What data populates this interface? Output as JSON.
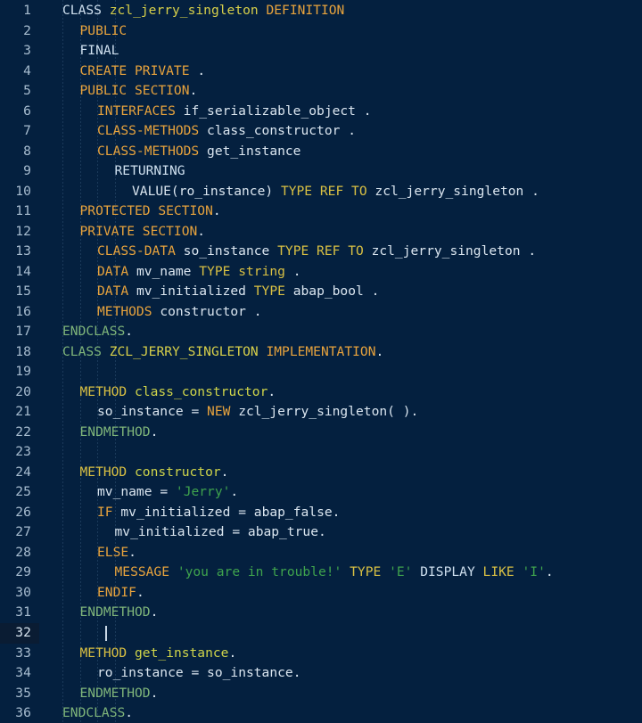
{
  "editor": {
    "language": "ABAP",
    "theme_background": "#04203f",
    "gutter_active_background": "#0a1c33",
    "colors": {
      "keyword_orange": "#e8a33d",
      "keyword_gold": "#d9c043",
      "identifier": "#dbe6f0",
      "class_name": "#d8d04a",
      "method_name": "#cfd44a",
      "string": "#3fa34d",
      "green_keyword": "#7fb57a",
      "light_blue": "#cfe0ef",
      "line_number": "#a8bdd0"
    },
    "cursor_line": 32,
    "total_lines": 36,
    "line_numbers": [
      1,
      2,
      3,
      4,
      5,
      6,
      7,
      8,
      9,
      10,
      11,
      12,
      13,
      14,
      15,
      16,
      17,
      18,
      19,
      20,
      21,
      22,
      23,
      24,
      25,
      26,
      27,
      28,
      29,
      30,
      31,
      32,
      33,
      34,
      35,
      36
    ],
    "lines": [
      {
        "num": 1,
        "indent": 0,
        "tokens": [
          {
            "t": "CLASS",
            "c": "lblue"
          },
          {
            "t": " ",
            "c": "id"
          },
          {
            "t": "zcl_jerry_singleton",
            "c": "cls"
          },
          {
            "t": " ",
            "c": "id"
          },
          {
            "t": "DEFINITION",
            "c": "kw"
          }
        ]
      },
      {
        "num": 2,
        "indent": 1,
        "tokens": [
          {
            "t": "PUBLIC",
            "c": "kw"
          }
        ]
      },
      {
        "num": 3,
        "indent": 1,
        "tokens": [
          {
            "t": "FINAL",
            "c": "lblue"
          }
        ]
      },
      {
        "num": 4,
        "indent": 1,
        "tokens": [
          {
            "t": "CREATE PRIVATE",
            "c": "kw"
          },
          {
            "t": " ",
            "c": "id"
          },
          {
            "t": ".",
            "c": "punct"
          }
        ]
      },
      {
        "num": 5,
        "indent": 1,
        "tokens": [
          {
            "t": "PUBLIC SECTION",
            "c": "kw"
          },
          {
            "t": ".",
            "c": "punct"
          }
        ]
      },
      {
        "num": 6,
        "indent": 2,
        "tokens": [
          {
            "t": "INTERFACES",
            "c": "kw"
          },
          {
            "t": " ",
            "c": "id"
          },
          {
            "t": "if_serializable_object",
            "c": "id"
          },
          {
            "t": " ",
            "c": "id"
          },
          {
            "t": ".",
            "c": "punct"
          }
        ]
      },
      {
        "num": 7,
        "indent": 2,
        "tokens": [
          {
            "t": "CLASS-METHODS",
            "c": "kw"
          },
          {
            "t": " ",
            "c": "id"
          },
          {
            "t": "class_constructor",
            "c": "id"
          },
          {
            "t": " ",
            "c": "id"
          },
          {
            "t": ".",
            "c": "punct"
          }
        ]
      },
      {
        "num": 8,
        "indent": 2,
        "tokens": [
          {
            "t": "CLASS-METHODS",
            "c": "kw"
          },
          {
            "t": " ",
            "c": "id"
          },
          {
            "t": "get_instance",
            "c": "id"
          }
        ]
      },
      {
        "num": 9,
        "indent": 3,
        "tokens": [
          {
            "t": "RETURNING",
            "c": "lblue"
          }
        ]
      },
      {
        "num": 10,
        "indent": 4,
        "tokens": [
          {
            "t": "VALUE(ro_instance)",
            "c": "id"
          },
          {
            "t": " ",
            "c": "id"
          },
          {
            "t": "TYPE REF TO",
            "c": "kw2"
          },
          {
            "t": " ",
            "c": "id"
          },
          {
            "t": "zcl_jerry_singleton",
            "c": "id"
          },
          {
            "t": " ",
            "c": "id"
          },
          {
            "t": ".",
            "c": "punct"
          }
        ]
      },
      {
        "num": 11,
        "indent": 1,
        "tokens": [
          {
            "t": "PROTECTED SECTION",
            "c": "kw"
          },
          {
            "t": ".",
            "c": "punct"
          }
        ]
      },
      {
        "num": 12,
        "indent": 1,
        "tokens": [
          {
            "t": "PRIVATE SECTION",
            "c": "kw"
          },
          {
            "t": ".",
            "c": "punct"
          }
        ]
      },
      {
        "num": 13,
        "indent": 2,
        "tokens": [
          {
            "t": "CLASS-DATA",
            "c": "kw"
          },
          {
            "t": " ",
            "c": "id"
          },
          {
            "t": "so_instance",
            "c": "id"
          },
          {
            "t": " ",
            "c": "id"
          },
          {
            "t": "TYPE REF TO",
            "c": "kw2"
          },
          {
            "t": " ",
            "c": "id"
          },
          {
            "t": "zcl_jerry_singleton",
            "c": "id"
          },
          {
            "t": " ",
            "c": "id"
          },
          {
            "t": ".",
            "c": "punct"
          }
        ]
      },
      {
        "num": 14,
        "indent": 2,
        "tokens": [
          {
            "t": "DATA",
            "c": "kw"
          },
          {
            "t": " ",
            "c": "id"
          },
          {
            "t": "mv_name",
            "c": "id"
          },
          {
            "t": " ",
            "c": "id"
          },
          {
            "t": "TYPE",
            "c": "kw2"
          },
          {
            "t": " ",
            "c": "id"
          },
          {
            "t": "string",
            "c": "kw2"
          },
          {
            "t": " ",
            "c": "id"
          },
          {
            "t": ".",
            "c": "punct"
          }
        ]
      },
      {
        "num": 15,
        "indent": 2,
        "tokens": [
          {
            "t": "DATA",
            "c": "kw"
          },
          {
            "t": " ",
            "c": "id"
          },
          {
            "t": "mv_initialized",
            "c": "id"
          },
          {
            "t": " ",
            "c": "id"
          },
          {
            "t": "TYPE",
            "c": "kw2"
          },
          {
            "t": " ",
            "c": "id"
          },
          {
            "t": "abap_bool",
            "c": "id"
          },
          {
            "t": " ",
            "c": "id"
          },
          {
            "t": ".",
            "c": "punct"
          }
        ]
      },
      {
        "num": 16,
        "indent": 2,
        "tokens": [
          {
            "t": "METHODS",
            "c": "kw"
          },
          {
            "t": " ",
            "c": "id"
          },
          {
            "t": "constructor",
            "c": "id"
          },
          {
            "t": " ",
            "c": "id"
          },
          {
            "t": ".",
            "c": "punct"
          }
        ]
      },
      {
        "num": 17,
        "indent": 0,
        "tokens": [
          {
            "t": "ENDCLASS",
            "c": "grn"
          },
          {
            "t": ".",
            "c": "punct"
          }
        ]
      },
      {
        "num": 18,
        "indent": 0,
        "tokens": [
          {
            "t": "CLASS",
            "c": "grn"
          },
          {
            "t": " ",
            "c": "id"
          },
          {
            "t": "ZCL_JERRY_SINGLETON",
            "c": "cls"
          },
          {
            "t": " ",
            "c": "id"
          },
          {
            "t": "IMPLEMENTATION",
            "c": "kw"
          },
          {
            "t": ".",
            "c": "punct"
          }
        ]
      },
      {
        "num": 19,
        "indent": 0,
        "tokens": []
      },
      {
        "num": 20,
        "indent": 1,
        "tokens": [
          {
            "t": "METHOD",
            "c": "kw2"
          },
          {
            "t": " ",
            "c": "id"
          },
          {
            "t": "class_constructor",
            "c": "mname"
          },
          {
            "t": ".",
            "c": "punct"
          }
        ]
      },
      {
        "num": 21,
        "indent": 2,
        "tokens": [
          {
            "t": "so_instance",
            "c": "id"
          },
          {
            "t": " ",
            "c": "id"
          },
          {
            "t": "=",
            "c": "op"
          },
          {
            "t": " ",
            "c": "id"
          },
          {
            "t": "NEW",
            "c": "kw"
          },
          {
            "t": " ",
            "c": "id"
          },
          {
            "t": "zcl_jerry_singleton( )",
            "c": "id"
          },
          {
            "t": ".",
            "c": "punct"
          }
        ]
      },
      {
        "num": 22,
        "indent": 1,
        "tokens": [
          {
            "t": "ENDMETHOD",
            "c": "grn"
          },
          {
            "t": ".",
            "c": "punct"
          }
        ]
      },
      {
        "num": 23,
        "indent": 0,
        "tokens": []
      },
      {
        "num": 24,
        "indent": 1,
        "tokens": [
          {
            "t": "METHOD",
            "c": "kw2"
          },
          {
            "t": " ",
            "c": "id"
          },
          {
            "t": "constructor",
            "c": "mname"
          },
          {
            "t": ".",
            "c": "punct"
          }
        ]
      },
      {
        "num": 25,
        "indent": 2,
        "tokens": [
          {
            "t": "mv_name",
            "c": "id"
          },
          {
            "t": " ",
            "c": "id"
          },
          {
            "t": "=",
            "c": "op"
          },
          {
            "t": " ",
            "c": "id"
          },
          {
            "t": "'Jerry'",
            "c": "str"
          },
          {
            "t": ".",
            "c": "punct"
          }
        ]
      },
      {
        "num": 26,
        "indent": 2,
        "tokens": [
          {
            "t": "IF",
            "c": "kw"
          },
          {
            "t": " ",
            "c": "id"
          },
          {
            "t": "mv_initialized",
            "c": "id"
          },
          {
            "t": " ",
            "c": "id"
          },
          {
            "t": "=",
            "c": "op"
          },
          {
            "t": " ",
            "c": "id"
          },
          {
            "t": "abap_false",
            "c": "id"
          },
          {
            "t": ".",
            "c": "punct"
          }
        ]
      },
      {
        "num": 27,
        "indent": 3,
        "tokens": [
          {
            "t": "mv_initialized",
            "c": "id"
          },
          {
            "t": " ",
            "c": "id"
          },
          {
            "t": "=",
            "c": "op"
          },
          {
            "t": " ",
            "c": "id"
          },
          {
            "t": "abap_true",
            "c": "id"
          },
          {
            "t": ".",
            "c": "punct"
          }
        ]
      },
      {
        "num": 28,
        "indent": 2,
        "tokens": [
          {
            "t": "ELSE",
            "c": "kw"
          },
          {
            "t": ".",
            "c": "punct"
          }
        ]
      },
      {
        "num": 29,
        "indent": 3,
        "tokens": [
          {
            "t": "MESSAGE",
            "c": "kw"
          },
          {
            "t": " ",
            "c": "id"
          },
          {
            "t": "'you are in trouble!'",
            "c": "str"
          },
          {
            "t": " ",
            "c": "id"
          },
          {
            "t": "TYPE",
            "c": "kw2"
          },
          {
            "t": " ",
            "c": "id"
          },
          {
            "t": "'E'",
            "c": "str"
          },
          {
            "t": " ",
            "c": "id"
          },
          {
            "t": "DISPLAY",
            "c": "lblue"
          },
          {
            "t": " ",
            "c": "id"
          },
          {
            "t": "LIKE",
            "c": "kw2"
          },
          {
            "t": " ",
            "c": "id"
          },
          {
            "t": "'I'",
            "c": "str"
          },
          {
            "t": ".",
            "c": "punct"
          }
        ]
      },
      {
        "num": 30,
        "indent": 2,
        "tokens": [
          {
            "t": "ENDIF",
            "c": "kw"
          },
          {
            "t": ".",
            "c": "punct"
          }
        ]
      },
      {
        "num": 31,
        "indent": 1,
        "tokens": [
          {
            "t": "ENDMETHOD",
            "c": "grn"
          },
          {
            "t": ".",
            "c": "punct"
          }
        ]
      },
      {
        "num": 32,
        "indent": 0,
        "tokens": []
      },
      {
        "num": 33,
        "indent": 1,
        "tokens": [
          {
            "t": "METHOD",
            "c": "kw2"
          },
          {
            "t": " ",
            "c": "id"
          },
          {
            "t": "get_instance",
            "c": "mname"
          },
          {
            "t": ".",
            "c": "punct"
          }
        ]
      },
      {
        "num": 34,
        "indent": 2,
        "tokens": [
          {
            "t": "ro_instance",
            "c": "id"
          },
          {
            "t": " ",
            "c": "id"
          },
          {
            "t": "=",
            "c": "op"
          },
          {
            "t": " ",
            "c": "id"
          },
          {
            "t": "so_instance",
            "c": "id"
          },
          {
            "t": ".",
            "c": "punct"
          }
        ]
      },
      {
        "num": 35,
        "indent": 1,
        "tokens": [
          {
            "t": "ENDMETHOD",
            "c": "grn"
          },
          {
            "t": ".",
            "c": "punct"
          }
        ]
      },
      {
        "num": 36,
        "indent": 0,
        "tokens": [
          {
            "t": "ENDCLASS",
            "c": "grn"
          },
          {
            "t": ".",
            "c": "punct"
          }
        ]
      }
    ],
    "plain_text": [
      "CLASS zcl_jerry_singleton DEFINITION",
      "  PUBLIC",
      "  FINAL",
      "  CREATE PRIVATE .",
      "  PUBLIC SECTION.",
      "    INTERFACES if_serializable_object .",
      "    CLASS-METHODS class_constructor .",
      "    CLASS-METHODS get_instance",
      "      RETURNING",
      "        VALUE(ro_instance) TYPE REF TO zcl_jerry_singleton .",
      "  PROTECTED SECTION.",
      "  PRIVATE SECTION.",
      "    CLASS-DATA so_instance TYPE REF TO zcl_jerry_singleton .",
      "    DATA mv_name TYPE string .",
      "    DATA mv_initialized TYPE abap_bool .",
      "    METHODS constructor .",
      "ENDCLASS.",
      "CLASS ZCL_JERRY_SINGLETON IMPLEMENTATION.",
      "",
      "  METHOD class_constructor.",
      "    so_instance = NEW zcl_jerry_singleton( ).",
      "  ENDMETHOD.",
      "",
      "  METHOD constructor.",
      "    mv_name = 'Jerry'.",
      "    IF mv_initialized = abap_false.",
      "      mv_initialized = abap_true.",
      "    ELSE.",
      "      MESSAGE 'you are in trouble!' TYPE 'E' DISPLAY LIKE 'I'.",
      "    ENDIF.",
      "  ENDMETHOD.",
      "",
      "  METHOD get_instance.",
      "    ro_instance = so_instance.",
      "  ENDMETHOD.",
      "ENDCLASS."
    ]
  }
}
